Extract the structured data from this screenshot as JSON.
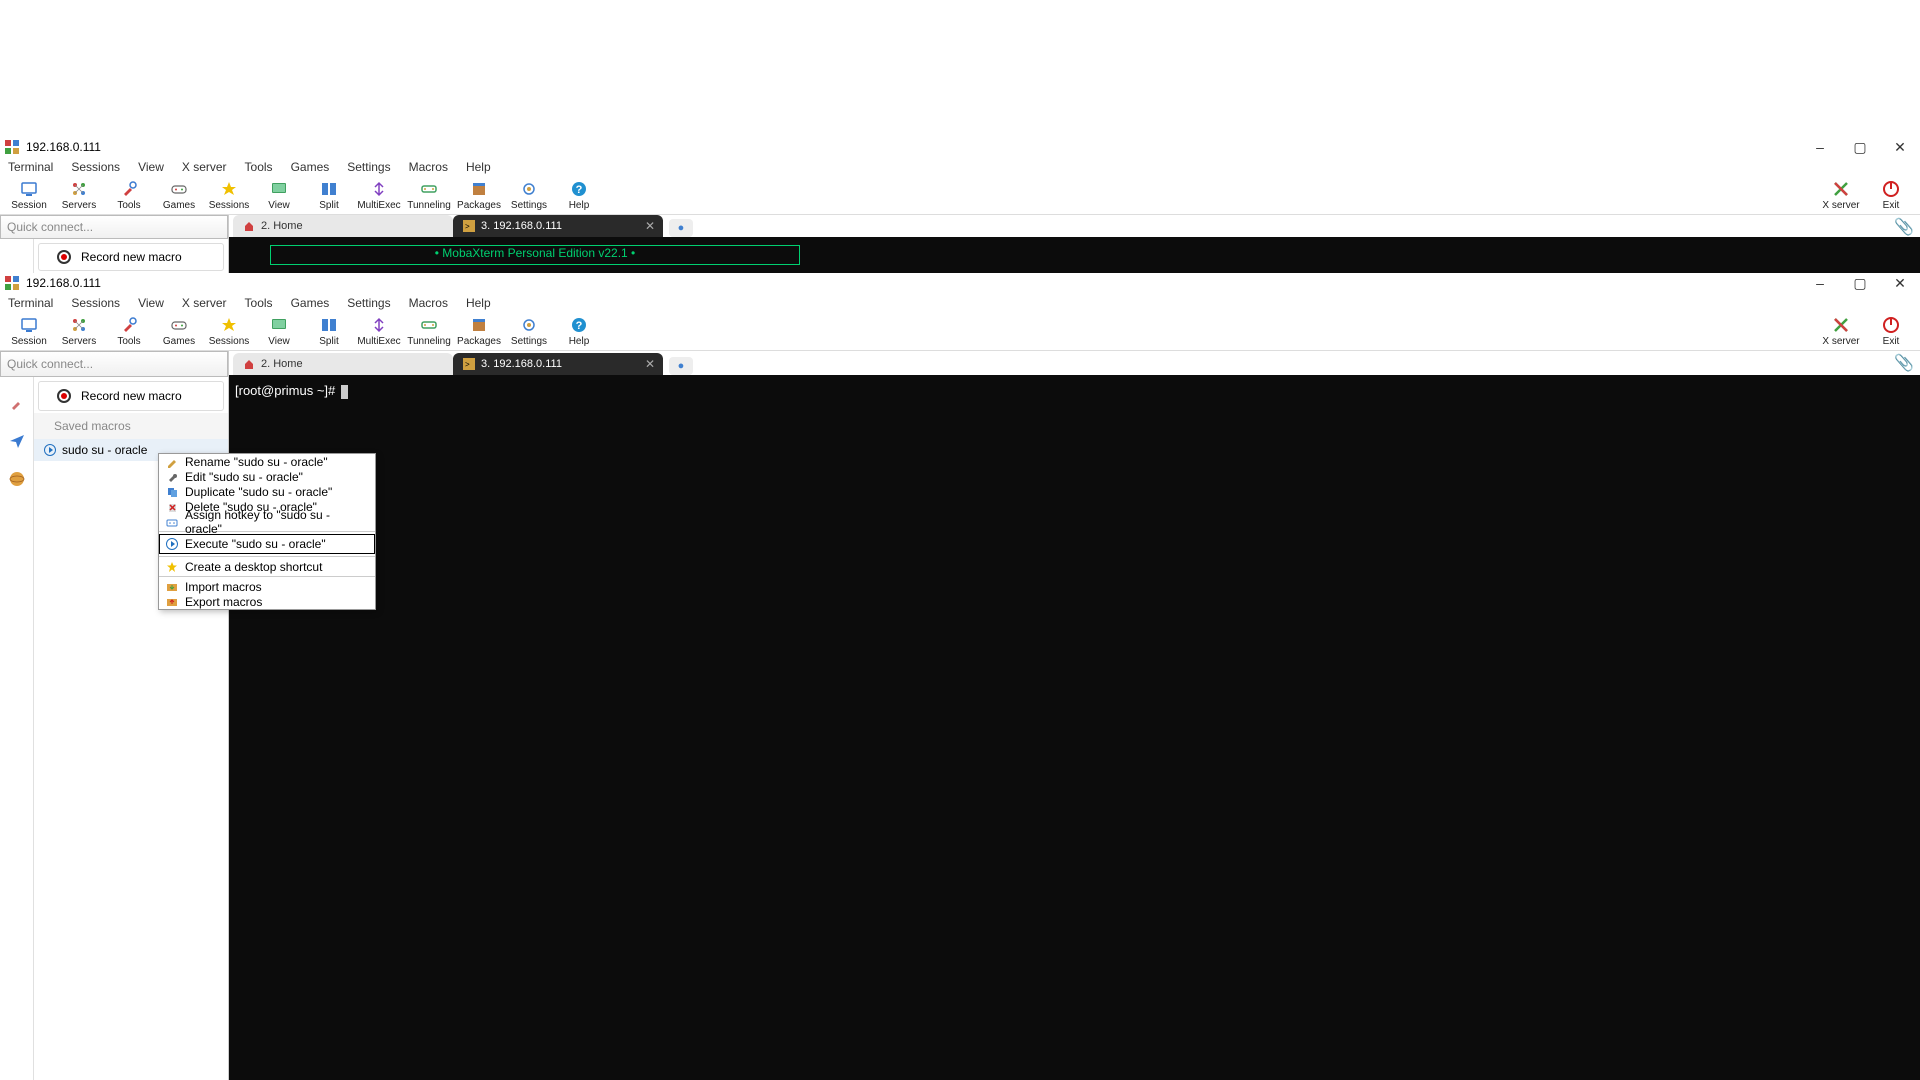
{
  "window": {
    "title": "192.168.0.111",
    "minimize": "–",
    "maximize": "▢",
    "close": "✕"
  },
  "menu": {
    "items": [
      "Terminal",
      "Sessions",
      "View",
      "X server",
      "Tools",
      "Games",
      "Settings",
      "Macros",
      "Help"
    ]
  },
  "toolbar": {
    "items": [
      "Session",
      "Servers",
      "Tools",
      "Games",
      "Sessions",
      "View",
      "Split",
      "MultiExec",
      "Tunneling",
      "Packages",
      "Settings",
      "Help"
    ],
    "right": [
      "X server",
      "Exit"
    ]
  },
  "sidebar": {
    "quick_connect_placeholder": "Quick connect...",
    "record_macro": "Record new macro",
    "saved_macros_label": "Saved macros",
    "macro_item": "sudo su - oracle"
  },
  "tabs": {
    "home": "2. Home",
    "active": "3. 192.168.0.111",
    "add": "+"
  },
  "terminal1": {
    "banner": "• MobaXterm Personal Edition v22.1 •"
  },
  "terminal2": {
    "prompt": "[root@primus ~]# "
  },
  "context_menu": {
    "rename": "Rename \"sudo su - oracle\"",
    "edit": "Edit \"sudo su - oracle\"",
    "duplicate": "Duplicate \"sudo su - oracle\"",
    "delete": "Delete \"sudo su - oracle\"",
    "hotkey": "Assign hotkey to \"sudo su - oracle\"",
    "execute": "Execute \"sudo su - oracle\"",
    "shortcut": "Create a desktop shortcut",
    "import": "Import macros",
    "export": "Export macros"
  }
}
